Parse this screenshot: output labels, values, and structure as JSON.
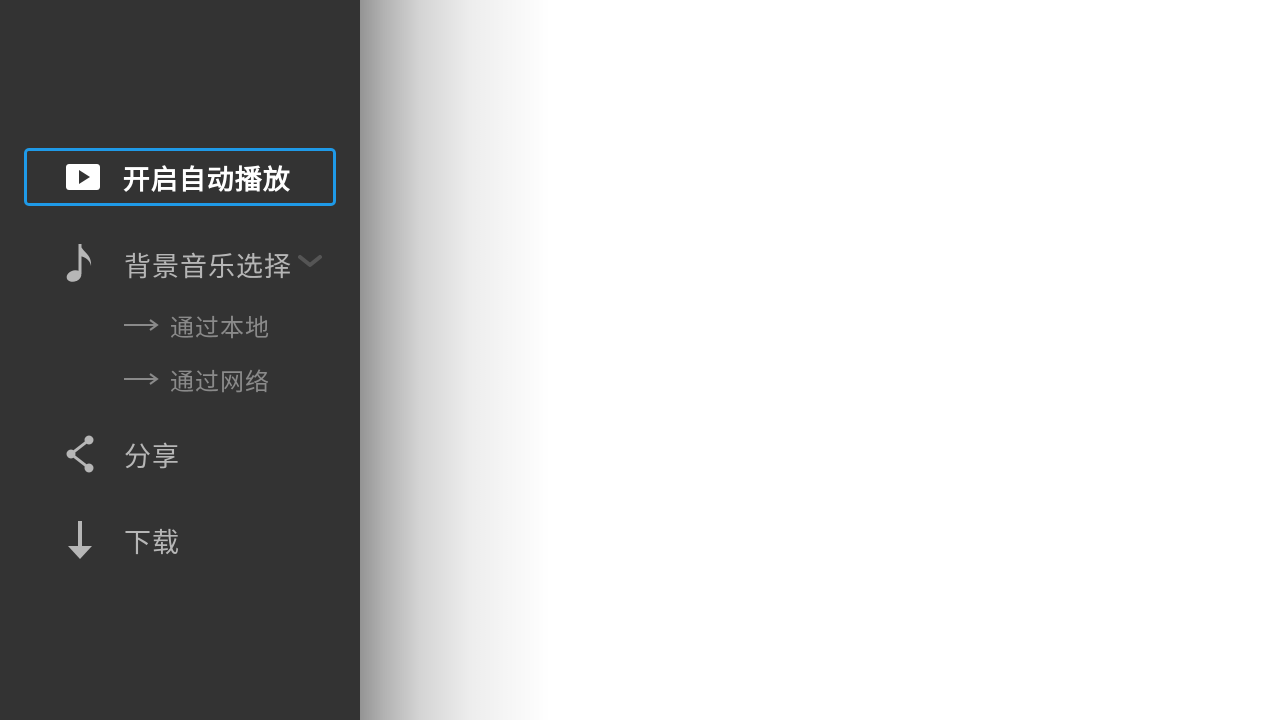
{
  "menu": {
    "autoplay": {
      "label": "开启自动播放",
      "icon": "play-icon",
      "active": true
    },
    "music": {
      "label": "背景音乐选择",
      "icon": "music-note-icon",
      "expanded_icon": "chevron-down-icon",
      "sub_items": [
        {
          "label": "通过本地",
          "icon": "arrow-right-icon"
        },
        {
          "label": "通过网络",
          "icon": "arrow-right-icon"
        }
      ]
    },
    "share": {
      "label": "分享",
      "icon": "share-icon"
    },
    "download": {
      "label": "下载",
      "icon": "download-arrow-icon"
    }
  },
  "colors": {
    "sidebar_bg": "#333333",
    "active_border": "#1f9ae8",
    "active_text": "#ffffff",
    "item_text": "#b6b6b6",
    "sub_text": "#8a8a8a",
    "content_bg": "#ffffff"
  }
}
